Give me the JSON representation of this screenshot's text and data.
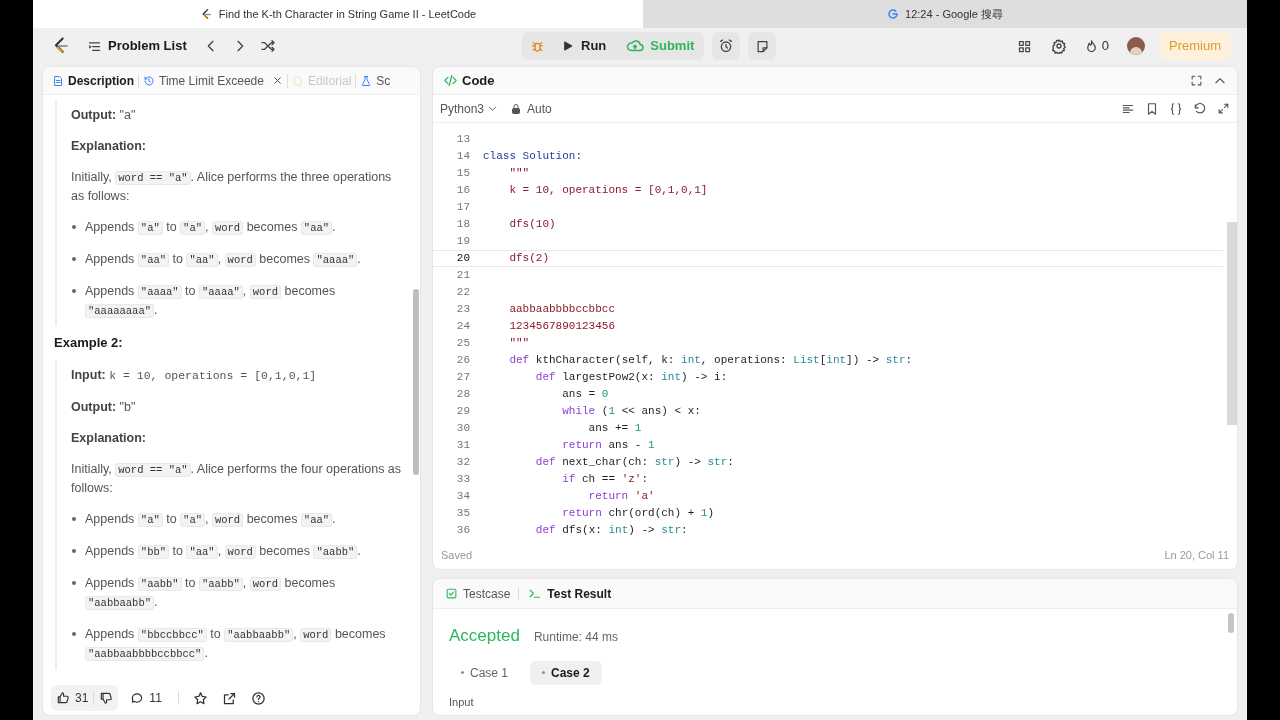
{
  "browser_tabs": [
    {
      "title": "Find the K-th Character in String Game II - LeetCode",
      "selected": true
    },
    {
      "title": "12:24 - Google 搜尋",
      "selected": false
    }
  ],
  "nav": {
    "problem_list": "Problem List",
    "run": "Run",
    "submit": "Submit",
    "streak": "0",
    "premium": "Premium"
  },
  "description_tabs": [
    {
      "label": "Description",
      "kind": "doc",
      "selected": true,
      "disabled": false,
      "closable": false
    },
    {
      "label": "Time Limit Exceede",
      "kind": "clock",
      "selected": false,
      "disabled": false,
      "closable": true
    },
    {
      "label": "Editorial",
      "kind": "book",
      "selected": false,
      "disabled": true,
      "closable": false
    },
    {
      "label": "Sc",
      "kind": "flask",
      "selected": false,
      "disabled": false,
      "closable": false
    }
  ],
  "description": [
    {
      "kind": "field",
      "label": "Output:",
      "segments": [
        {
          "text": "\"a\"",
          "kind": "plain"
        }
      ]
    },
    {
      "kind": "subheading",
      "text": "Explanation:"
    },
    {
      "kind": "paragraph",
      "segments": [
        {
          "text": "Initially, ",
          "kind": "plain"
        },
        {
          "text": "word == \"a\"",
          "kind": "code"
        },
        {
          "text": ". Alice performs the three operations as follows:",
          "kind": "plain"
        }
      ]
    },
    {
      "kind": "bullet",
      "segments": [
        {
          "text": "Appends ",
          "kind": "plain"
        },
        {
          "text": "\"a\"",
          "kind": "code"
        },
        {
          "text": " to ",
          "kind": "plain"
        },
        {
          "text": "\"a\"",
          "kind": "code"
        },
        {
          "text": ", ",
          "kind": "plain"
        },
        {
          "text": "word",
          "kind": "code"
        },
        {
          "text": " becomes ",
          "kind": "plain"
        },
        {
          "text": "\"aa\"",
          "kind": "code"
        },
        {
          "text": ".",
          "kind": "plain"
        }
      ]
    },
    {
      "kind": "bullet",
      "segments": [
        {
          "text": "Appends ",
          "kind": "plain"
        },
        {
          "text": "\"aa\"",
          "kind": "code"
        },
        {
          "text": " to ",
          "kind": "plain"
        },
        {
          "text": "\"aa\"",
          "kind": "code"
        },
        {
          "text": ", ",
          "kind": "plain"
        },
        {
          "text": "word",
          "kind": "code"
        },
        {
          "text": " becomes ",
          "kind": "plain"
        },
        {
          "text": "\"aaaa\"",
          "kind": "code"
        },
        {
          "text": ".",
          "kind": "plain"
        }
      ]
    },
    {
      "kind": "bullet",
      "segments": [
        {
          "text": "Appends ",
          "kind": "plain"
        },
        {
          "text": "\"aaaa\"",
          "kind": "code"
        },
        {
          "text": " to ",
          "kind": "plain"
        },
        {
          "text": "\"aaaa\"",
          "kind": "code"
        },
        {
          "text": ", ",
          "kind": "plain"
        },
        {
          "text": "word",
          "kind": "code"
        },
        {
          "text": " becomes ",
          "kind": "plain"
        },
        {
          "text": "\"aaaaaaaa\"",
          "kind": "code"
        },
        {
          "text": ".",
          "kind": "plain"
        }
      ]
    },
    {
      "kind": "heading",
      "text": "Example 2:"
    },
    {
      "kind": "field",
      "label": "Input:",
      "segments": [
        {
          "text": "k = 10, operations = [0,1,0,1]",
          "kind": "mono"
        }
      ]
    },
    {
      "kind": "field",
      "label": "Output:",
      "segments": [
        {
          "text": "\"b\"",
          "kind": "plain"
        }
      ]
    },
    {
      "kind": "subheading",
      "text": "Explanation:"
    },
    {
      "kind": "paragraph",
      "segments": [
        {
          "text": "Initially, ",
          "kind": "plain"
        },
        {
          "text": "word == \"a\"",
          "kind": "code"
        },
        {
          "text": ". Alice performs the four operations as follows:",
          "kind": "plain"
        }
      ]
    },
    {
      "kind": "bullet",
      "segments": [
        {
          "text": "Appends ",
          "kind": "plain"
        },
        {
          "text": "\"a\"",
          "kind": "code"
        },
        {
          "text": " to ",
          "kind": "plain"
        },
        {
          "text": "\"a\"",
          "kind": "code"
        },
        {
          "text": ", ",
          "kind": "plain"
        },
        {
          "text": "word",
          "kind": "code"
        },
        {
          "text": " becomes ",
          "kind": "plain"
        },
        {
          "text": "\"aa\"",
          "kind": "code"
        },
        {
          "text": ".",
          "kind": "plain"
        }
      ]
    },
    {
      "kind": "bullet",
      "segments": [
        {
          "text": "Appends ",
          "kind": "plain"
        },
        {
          "text": "\"bb\"",
          "kind": "code"
        },
        {
          "text": " to ",
          "kind": "plain"
        },
        {
          "text": "\"aa\"",
          "kind": "code"
        },
        {
          "text": ", ",
          "kind": "plain"
        },
        {
          "text": "word",
          "kind": "code"
        },
        {
          "text": " becomes ",
          "kind": "plain"
        },
        {
          "text": "\"aabb\"",
          "kind": "code"
        },
        {
          "text": ".",
          "kind": "plain"
        }
      ]
    },
    {
      "kind": "bullet",
      "segments": [
        {
          "text": "Appends ",
          "kind": "plain"
        },
        {
          "text": "\"aabb\"",
          "kind": "code"
        },
        {
          "text": " to ",
          "kind": "plain"
        },
        {
          "text": "\"aabb\"",
          "kind": "code"
        },
        {
          "text": ", ",
          "kind": "plain"
        },
        {
          "text": "word",
          "kind": "code"
        },
        {
          "text": " becomes ",
          "kind": "plain"
        },
        {
          "text": "\"aabbaabb\"",
          "kind": "code"
        },
        {
          "text": ".",
          "kind": "plain"
        }
      ]
    },
    {
      "kind": "bullet",
      "segments": [
        {
          "text": "Appends ",
          "kind": "plain"
        },
        {
          "text": "\"bbccbbcc\"",
          "kind": "code"
        },
        {
          "text": " to ",
          "kind": "plain"
        },
        {
          "text": "\"aabbaabb\"",
          "kind": "code"
        },
        {
          "text": ", ",
          "kind": "plain"
        },
        {
          "text": "word",
          "kind": "code"
        },
        {
          "text": " becomes ",
          "kind": "plain"
        },
        {
          "text": "\"aabbaabbbbccbbcc\"",
          "kind": "code"
        },
        {
          "text": ".",
          "kind": "plain"
        }
      ]
    }
  ],
  "reactions": {
    "likes": "31",
    "comments": "11"
  },
  "editor": {
    "title": "Code",
    "language": "Python3",
    "mode": "Auto",
    "status": "Saved",
    "cursor": "Ln 20, Col 11",
    "lines": [
      {
        "number": "13",
        "current": false
      },
      {
        "number": "14",
        "current": false,
        "tokens": [
          {
            "text": "class Solution",
            "kind": "class"
          },
          {
            "text": ":",
            "kind": "plain"
          }
        ]
      },
      {
        "number": "15",
        "current": false,
        "tokens": [
          {
            "text": "    \"\"\"",
            "kind": "string"
          }
        ]
      },
      {
        "number": "16",
        "current": false,
        "tokens": [
          {
            "text": "    k = 10, operations = [0,1,0,1]",
            "kind": "string"
          }
        ]
      },
      {
        "number": "17",
        "current": false
      },
      {
        "number": "18",
        "current": false,
        "tokens": [
          {
            "text": "    dfs(10)",
            "kind": "string"
          }
        ]
      },
      {
        "number": "19",
        "current": false
      },
      {
        "number": "20",
        "current": true,
        "tokens": [
          {
            "text": "    dfs(2)",
            "kind": "string"
          }
        ]
      },
      {
        "number": "21",
        "current": false
      },
      {
        "number": "22",
        "current": false
      },
      {
        "number": "23",
        "current": false,
        "tokens": [
          {
            "text": "    aabbaabbbbccbbcc",
            "kind": "string"
          }
        ]
      },
      {
        "number": "24",
        "current": false,
        "tokens": [
          {
            "text": "    1234567890123456",
            "kind": "string"
          }
        ]
      },
      {
        "number": "25",
        "current": false,
        "tokens": [
          {
            "text": "    \"\"\"",
            "kind": "string"
          }
        ]
      },
      {
        "number": "26",
        "current": false,
        "tokens": [
          {
            "text": "    def",
            "kind": "keyword"
          },
          {
            "text": " kthCharacter(self, k: ",
            "kind": "plain"
          },
          {
            "text": "int",
            "kind": "type"
          },
          {
            "text": ", operations: ",
            "kind": "plain"
          },
          {
            "text": "List",
            "kind": "type"
          },
          {
            "text": "[",
            "kind": "plain"
          },
          {
            "text": "int",
            "kind": "type"
          },
          {
            "text": "]) -> ",
            "kind": "plain"
          },
          {
            "text": "str",
            "kind": "type"
          },
          {
            "text": ":",
            "kind": "plain"
          }
        ]
      },
      {
        "number": "27",
        "current": false,
        "tokens": [
          {
            "text": "        def",
            "kind": "keyword"
          },
          {
            "text": " largestPow2(x: ",
            "kind": "plain"
          },
          {
            "text": "int",
            "kind": "type"
          },
          {
            "text": ") -> i:",
            "kind": "plain"
          }
        ]
      },
      {
        "number": "28",
        "current": false,
        "tokens": [
          {
            "text": "            ans = ",
            "kind": "plain"
          },
          {
            "text": "0",
            "kind": "number"
          }
        ]
      },
      {
        "number": "29",
        "current": false,
        "tokens": [
          {
            "text": "            while",
            "kind": "keyword"
          },
          {
            "text": " (",
            "kind": "plain"
          },
          {
            "text": "1",
            "kind": "number"
          },
          {
            "text": " << ans) < x:",
            "kind": "plain"
          }
        ]
      },
      {
        "number": "30",
        "current": false,
        "tokens": [
          {
            "text": "                ans += ",
            "kind": "plain"
          },
          {
            "text": "1",
            "kind": "number"
          }
        ]
      },
      {
        "number": "31",
        "current": false,
        "tokens": [
          {
            "text": "            return",
            "kind": "keyword"
          },
          {
            "text": " ans - ",
            "kind": "plain"
          },
          {
            "text": "1",
            "kind": "number"
          }
        ]
      },
      {
        "number": "32",
        "current": false,
        "tokens": [
          {
            "text": "        def",
            "kind": "keyword"
          },
          {
            "text": " next_char(ch: ",
            "kind": "plain"
          },
          {
            "text": "str",
            "kind": "type"
          },
          {
            "text": ") -> ",
            "kind": "plain"
          },
          {
            "text": "str",
            "kind": "type"
          },
          {
            "text": ":",
            "kind": "plain"
          }
        ]
      },
      {
        "number": "33",
        "current": false,
        "tokens": [
          {
            "text": "            if",
            "kind": "keyword"
          },
          {
            "text": " ch == ",
            "kind": "plain"
          },
          {
            "text": "'z'",
            "kind": "string"
          },
          {
            "text": ":",
            "kind": "plain"
          }
        ]
      },
      {
        "number": "34",
        "current": false,
        "tokens": [
          {
            "text": "                return ",
            "kind": "keyword"
          },
          {
            "text": "'a'",
            "kind": "string"
          }
        ]
      },
      {
        "number": "35",
        "current": false,
        "tokens": [
          {
            "text": "            return",
            "kind": "keyword"
          },
          {
            "text": " chr(ord(ch) + ",
            "kind": "plain"
          },
          {
            "text": "1",
            "kind": "number"
          },
          {
            "text": ")",
            "kind": "plain"
          }
        ]
      },
      {
        "number": "36",
        "current": false,
        "tokens": [
          {
            "text": "        def",
            "kind": "keyword"
          },
          {
            "text": " dfs(x: ",
            "kind": "plain"
          },
          {
            "text": "int",
            "kind": "type"
          },
          {
            "text": ") -> ",
            "kind": "plain"
          },
          {
            "text": "str",
            "kind": "type"
          },
          {
            "text": ":",
            "kind": "plain"
          }
        ]
      }
    ]
  },
  "result_tabs": [
    {
      "label": "Testcase",
      "kind": "testcase",
      "selected": false
    },
    {
      "label": "Test Result",
      "kind": "terminal",
      "selected": true
    }
  ],
  "result": {
    "verdict": "Accepted",
    "runtime": "Runtime: 44 ms",
    "input_label": "Input",
    "cases": [
      {
        "label": "Case 1",
        "selected": false
      },
      {
        "label": "Case 2",
        "selected": true
      }
    ]
  }
}
